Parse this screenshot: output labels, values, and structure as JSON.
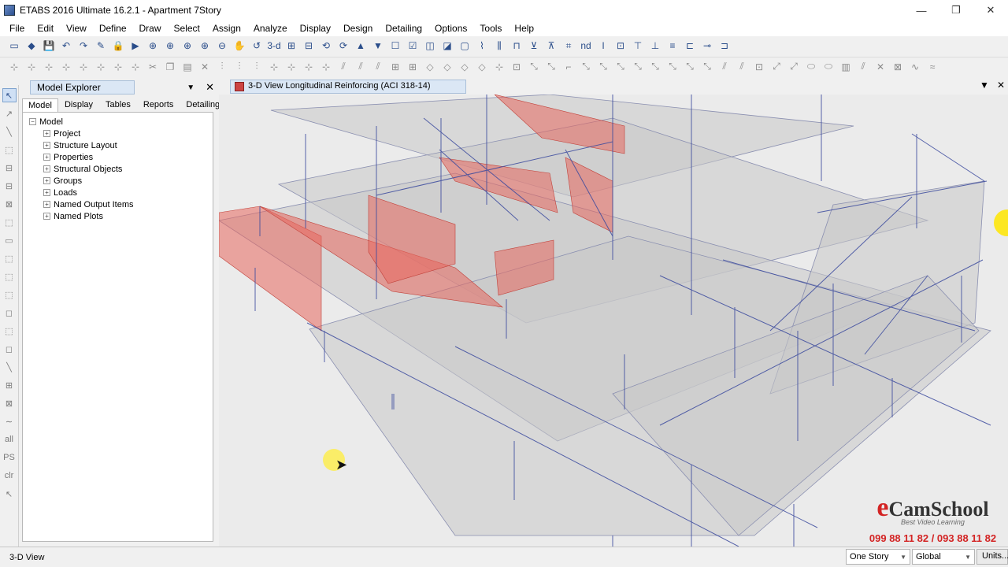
{
  "window": {
    "title": "ETABS 2016 Ultimate 16.2.1 - Apartment 7Story",
    "controls": {
      "minimize": "—",
      "restore": "❐",
      "close": "✕"
    }
  },
  "menu": [
    "File",
    "Edit",
    "View",
    "Define",
    "Draw",
    "Select",
    "Assign",
    "Analyze",
    "Display",
    "Design",
    "Detailing",
    "Options",
    "Tools",
    "Help"
  ],
  "toolbar1": [
    "▭",
    "◆",
    "💾",
    "↶",
    "↷",
    "✎",
    "🔒",
    "▶",
    "⊕",
    "⊕",
    "⊕",
    "⊕",
    "⊖",
    "✋",
    "↺",
    "3-d",
    "⊞",
    "⊟",
    "⟲",
    "⟳",
    "▲",
    "▼",
    "☐",
    "☑",
    "◫",
    "◪",
    "▢",
    "⌇",
    "⫼",
    "⊓",
    "⊻",
    "⊼",
    "⌗",
    "nd",
    "I",
    "⊡",
    "⊤",
    "⊥",
    "≡",
    "⊏",
    "⊸",
    "⊐"
  ],
  "toolbar2": [
    "⊹",
    "⊹",
    "⊹",
    "⊹",
    "⊹",
    "⊹",
    "⊹",
    "⊹",
    "✂",
    "❐",
    "▤",
    "✕",
    "⫶",
    "⫶",
    "⫶",
    "⊹",
    "⊹",
    "⊹",
    "⊹",
    "⫽",
    "⫽",
    "⫽",
    "⊞",
    "⊞",
    "◇",
    "◇",
    "◇",
    "◇",
    "⊹",
    "⊡",
    "⤡",
    "⤡",
    "⌐",
    "⤡",
    "⤡",
    "⤡",
    "⤡",
    "⤡",
    "⤡",
    "⤡",
    "⤡",
    "⫽",
    "⫽",
    "⊡",
    "⤢",
    "⤢",
    "⬭",
    "⬭",
    "▥",
    "⫽",
    "✕",
    "⊠",
    "∿",
    "≈"
  ],
  "left_tools": [
    "↖",
    "↗",
    "╲",
    "⬚",
    "⊟",
    "⊟",
    "⊠",
    "⬚",
    "▭",
    "⬚",
    "⬚",
    "⬚",
    "◻",
    "⬚",
    "◻",
    "╲",
    "⊞",
    "⊠",
    "∼",
    "all",
    "PS",
    "clr",
    "↖"
  ],
  "model_explorer": {
    "title": "Model Explorer",
    "tabs": [
      "Model",
      "Display",
      "Tables",
      "Reports",
      "Detailing"
    ],
    "active_tab": "Model",
    "root": "Model",
    "items": [
      "Project",
      "Structure Layout",
      "Properties",
      "Structural Objects",
      "Groups",
      "Loads",
      "Named Output Items",
      "Named Plots"
    ]
  },
  "view_tab": {
    "title": "3-D View  Longitudinal Reinforcing  (ACI 318-14)"
  },
  "brand": {
    "logo_e": "e",
    "logo_rest": "CamSchool",
    "tagline": "Best Video Learning",
    "phone": "099 88 11 82 / 093 88 11 82"
  },
  "status": {
    "left": "3-D View",
    "story_select": "One Story",
    "coord_select": "Global",
    "units_button": "Units..."
  },
  "colors": {
    "slab": "#c8c8c8",
    "grid_line": "#3b4a9e",
    "reinforcement": "#e8675f",
    "brand_red": "#d32424"
  }
}
